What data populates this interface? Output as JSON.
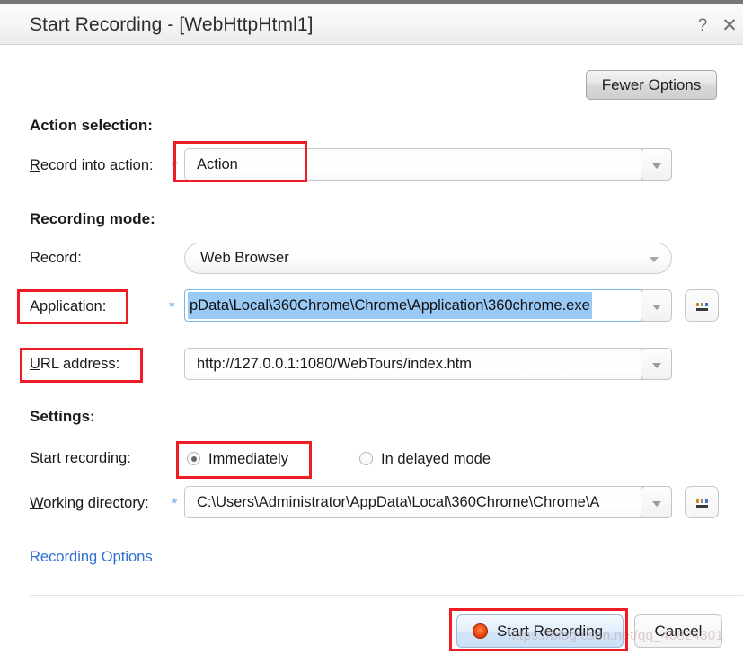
{
  "window": {
    "title": "Start Recording - [WebHttpHtml1]",
    "help_icon": "question-mark-icon",
    "close_icon": "close-icon"
  },
  "toolbar": {
    "fewer_options_label": "Fewer Options"
  },
  "action_selection": {
    "heading": "Action selection:",
    "record_into_action": {
      "label_prefix": "R",
      "label_rest": "ecord into action:",
      "required_marker": "*",
      "value": "Action"
    }
  },
  "recording_mode": {
    "heading": "Recording mode:",
    "record": {
      "label": "Record:",
      "value": "Web Browser"
    },
    "application": {
      "label": "Application:",
      "required_marker": "*",
      "value": "pData\\Local\\360Chrome\\Chrome\\Application\\360chrome.exe",
      "browse_label": "..."
    },
    "url_address": {
      "label_prefix": "U",
      "label_rest": "RL address:",
      "value": "http://127.0.0.1:1080/WebTours/index.htm"
    }
  },
  "settings": {
    "heading": "Settings:",
    "start_recording": {
      "label_prefix": "S",
      "label_rest": "tart recording:",
      "options": [
        {
          "label": "Immediately",
          "selected": true
        },
        {
          "label": "In delayed mode",
          "selected": false
        }
      ]
    },
    "working_directory": {
      "label_prefix": "W",
      "label_rest": "orking directory:",
      "required_marker": "*",
      "value": "C:\\Users\\Administrator\\AppData\\Local\\360Chrome\\Chrome\\A",
      "browse_label": "..."
    }
  },
  "recording_options_link": "Recording Options",
  "footer": {
    "start_button_label": "Start Recording",
    "start_button_icon": "record-circle-icon",
    "cancel_button_label": "Cancel"
  },
  "watermark": "https://blog.csdn.net/qq_46824301",
  "colors": {
    "annotation": "#ee1c25",
    "link": "#2f6fd0",
    "required_star": "#6fa8e8",
    "selection_highlight": "#99c9f5",
    "record_icon": "#ef4b11"
  }
}
